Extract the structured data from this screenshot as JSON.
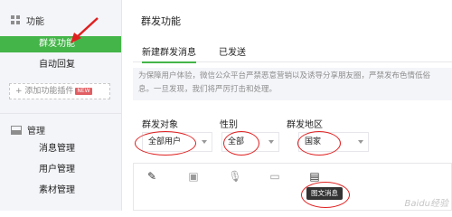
{
  "sidebar": {
    "feature_section": "功能",
    "feature_items": [
      {
        "label": "群发功能"
      },
      {
        "label": "自动回复"
      }
    ],
    "add_plugin_label": "+ 添加功能插件",
    "add_plugin_badge": "NEW",
    "manage_section": "管理",
    "manage_items": [
      {
        "label": "消息管理"
      },
      {
        "label": "用户管理"
      },
      {
        "label": "素材管理"
      }
    ]
  },
  "main": {
    "title": "群发功能",
    "tabs": [
      {
        "label": "新建群发消息"
      },
      {
        "label": "已发送"
      }
    ],
    "notice_line1": "为保障用户体验，微信公众平台严禁恶意营销以及诱导分享朋友圈，严禁发布色情低俗",
    "notice_line2": "息。一旦发现，我们将严厉打击和处理。",
    "filters": {
      "target_label": "群发对象",
      "target_value": "全部用户",
      "gender_label": "性别",
      "gender_value": "全部",
      "region_label": "群发地区",
      "region_value": "国家"
    },
    "editor": {
      "tools": [
        "pencil-icon",
        "image-icon",
        "voice-icon",
        "video-icon",
        "news-icon"
      ],
      "tooltip": "图文消息"
    }
  },
  "watermark": "Baidu经验",
  "colors": {
    "accent": "#44b549",
    "highlight": "#e02020"
  }
}
